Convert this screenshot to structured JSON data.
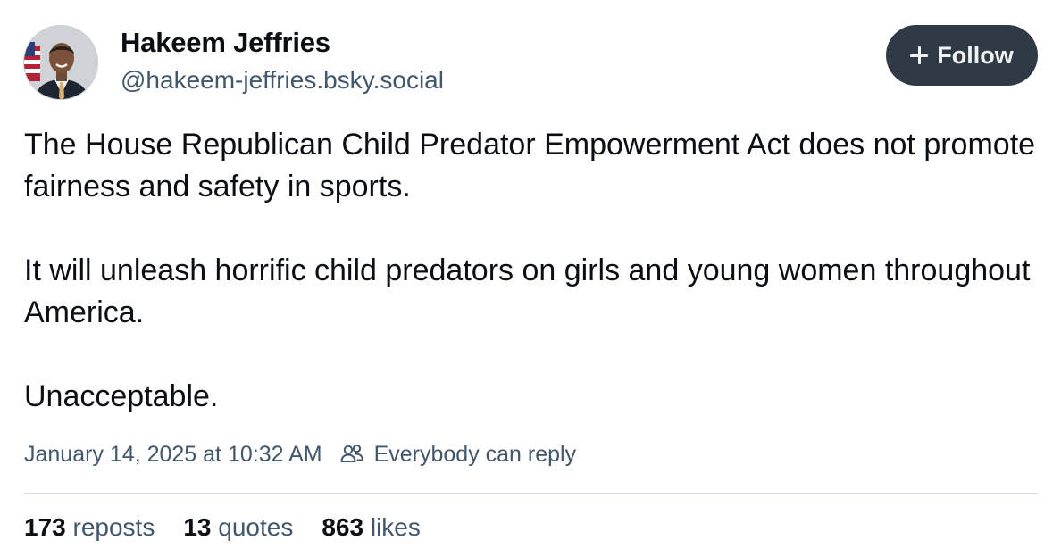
{
  "author": {
    "name": "Hakeem Jeffries",
    "handle": "@hakeem-jeffries.bsky.social",
    "avatar_icon": "profile-photo-icon"
  },
  "follow_button": {
    "label": "Follow",
    "icon": "plus-icon",
    "background": "#2f3a46"
  },
  "post": {
    "paragraphs": [
      "The House Republican Child Predator Empowerment Act does not promote fairness and safety in sports.",
      "It will unleash horrific child predators on girls and young women throughout America.",
      "Unacceptable."
    ]
  },
  "meta": {
    "timestamp": "January 14, 2025 at 10:32 AM",
    "reply_icon": "people-icon",
    "reply_setting": "Everybody can reply"
  },
  "stats": {
    "reposts": {
      "count": "173",
      "label": "reposts"
    },
    "quotes": {
      "count": "13",
      "label": "quotes"
    },
    "likes": {
      "count": "863",
      "label": "likes"
    }
  },
  "colors": {
    "text": "#0b0f14",
    "secondary_text": "#42576c",
    "divider": "#d4dbe2"
  }
}
